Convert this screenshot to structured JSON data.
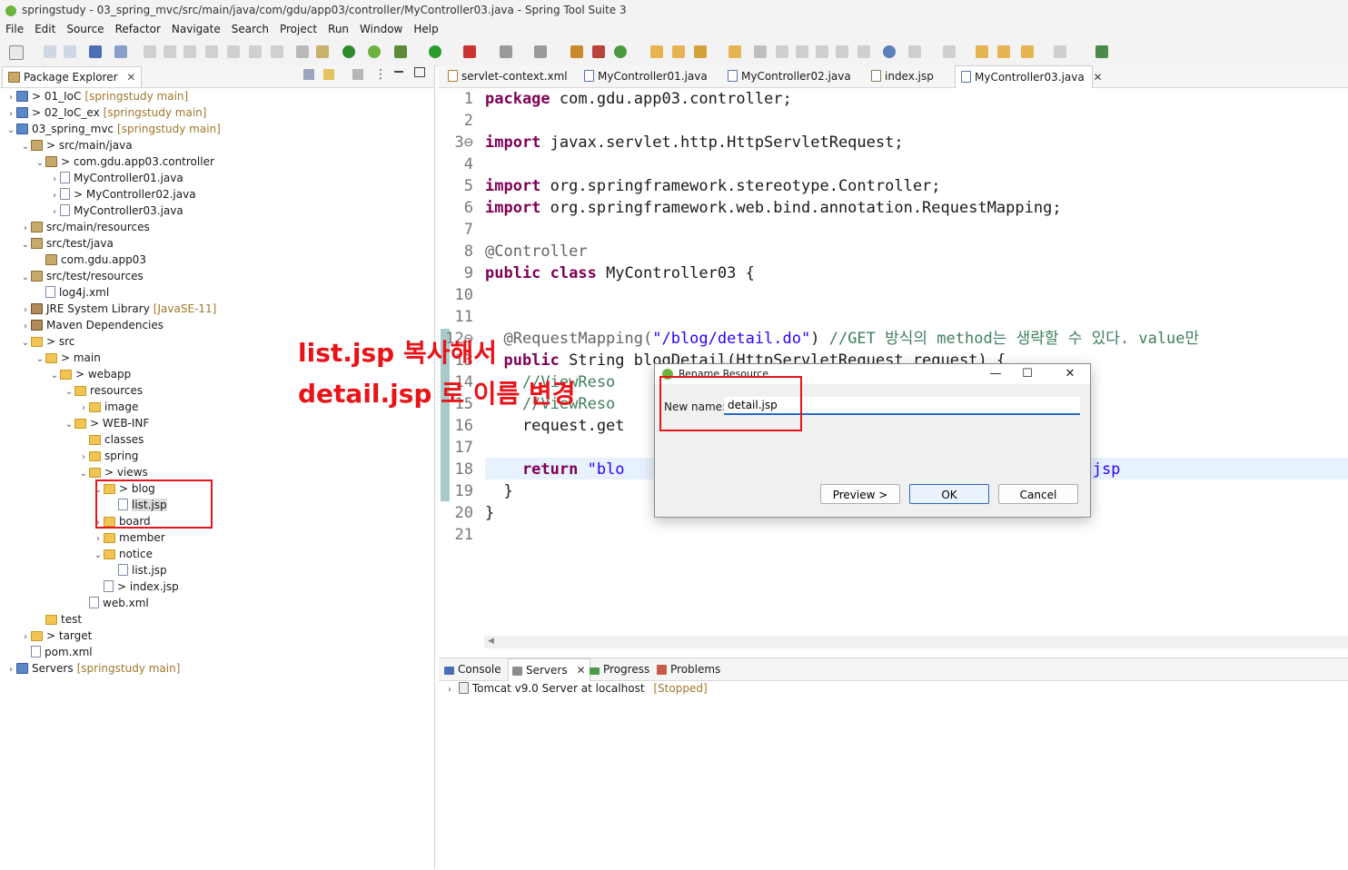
{
  "window": {
    "title": "springstudy - 03_spring_mvc/src/main/java/com/gdu/app03/controller/MyController03.java - Spring Tool Suite 3"
  },
  "menu": [
    "File",
    "Edit",
    "Source",
    "Refactor",
    "Navigate",
    "Search",
    "Project",
    "Run",
    "Window",
    "Help"
  ],
  "package_explorer": {
    "tab_label": "Package Explorer",
    "close_glyph": "✕",
    "tree": [
      {
        "label": "> 01_IoC",
        "suffix": "[springstudy main]",
        "icon": "project-icon",
        "twisty": "›"
      },
      {
        "label": "> 02_IoC_ex",
        "suffix": "[springstudy main]",
        "icon": "project-icon",
        "twisty": "›"
      },
      {
        "label": "03_spring_mvc",
        "suffix": "[springstudy main]",
        "icon": "project-icon",
        "twisty": "⌄"
      },
      {
        "label": "> src/main/java",
        "suffix": "",
        "icon": "source-folder-icon",
        "twisty": "⌄"
      },
      {
        "label": "> com.gdu.app03.controller",
        "suffix": "",
        "icon": "package-icon",
        "twisty": "⌄"
      },
      {
        "label": "MyController01.java",
        "suffix": "",
        "icon": "java-file-icon",
        "twisty": "›"
      },
      {
        "label": "> MyController02.java",
        "suffix": "",
        "icon": "java-file-icon",
        "twisty": "›"
      },
      {
        "label": "MyController03.java",
        "suffix": "",
        "icon": "java-file-icon",
        "twisty": "›"
      },
      {
        "label": "src/main/resources",
        "suffix": "",
        "icon": "source-folder-icon",
        "twisty": "›"
      },
      {
        "label": "src/test/java",
        "suffix": "",
        "icon": "source-folder-icon",
        "twisty": "⌄"
      },
      {
        "label": "com.gdu.app03",
        "suffix": "",
        "icon": "package-icon",
        "twisty": ""
      },
      {
        "label": "src/test/resources",
        "suffix": "",
        "icon": "source-folder-icon",
        "twisty": "⌄"
      },
      {
        "label": "log4j.xml",
        "suffix": "",
        "icon": "xml-file-icon",
        "twisty": ""
      },
      {
        "label": "JRE System Library",
        "suffix": "[JavaSE-11]",
        "icon": "library-icon",
        "twisty": "›"
      },
      {
        "label": "Maven Dependencies",
        "suffix": "",
        "icon": "library-icon",
        "twisty": "›"
      },
      {
        "label": "> src",
        "suffix": "",
        "icon": "folder-icon",
        "twisty": "⌄"
      },
      {
        "label": "> main",
        "suffix": "",
        "icon": "folder-icon",
        "twisty": "⌄"
      },
      {
        "label": "> webapp",
        "suffix": "",
        "icon": "folder-icon",
        "twisty": "⌄"
      },
      {
        "label": "resources",
        "suffix": "",
        "icon": "folder-icon",
        "twisty": "⌄"
      },
      {
        "label": "image",
        "suffix": "",
        "icon": "folder-icon",
        "twisty": "›"
      },
      {
        "label": "> WEB-INF",
        "suffix": "",
        "icon": "folder-icon",
        "twisty": "⌄"
      },
      {
        "label": "classes",
        "suffix": "",
        "icon": "folder-icon",
        "twisty": ""
      },
      {
        "label": "spring",
        "suffix": "",
        "icon": "folder-icon",
        "twisty": "›"
      },
      {
        "label": "> views",
        "suffix": "",
        "icon": "folder-icon",
        "twisty": "⌄"
      },
      {
        "label": "> blog",
        "suffix": "",
        "icon": "folder-icon",
        "twisty": "⌄"
      },
      {
        "label": "list.jsp",
        "suffix": "",
        "icon": "jsp-file-icon",
        "twisty": ""
      },
      {
        "label": "board",
        "suffix": "",
        "icon": "folder-icon",
        "twisty": "›"
      },
      {
        "label": "member",
        "suffix": "",
        "icon": "folder-icon",
        "twisty": "›"
      },
      {
        "label": "notice",
        "suffix": "",
        "icon": "folder-icon",
        "twisty": "⌄"
      },
      {
        "label": "list.jsp",
        "suffix": "",
        "icon": "jsp-file-icon",
        "twisty": ""
      },
      {
        "label": "> index.jsp",
        "suffix": "",
        "icon": "jsp-file-icon",
        "twisty": ""
      },
      {
        "label": "web.xml",
        "suffix": "",
        "icon": "xml-file-icon",
        "twisty": ""
      },
      {
        "label": "test",
        "suffix": "",
        "icon": "folder-icon",
        "twisty": ""
      },
      {
        "label": "> target",
        "suffix": "",
        "icon": "folder-icon",
        "twisty": "›"
      },
      {
        "label": "pom.xml",
        "suffix": "",
        "icon": "xml-file-icon",
        "twisty": ""
      },
      {
        "label": "Servers",
        "suffix": "[springstudy main]",
        "icon": "project-icon",
        "twisty": "›"
      }
    ]
  },
  "editor": {
    "tabs": [
      {
        "label": "servlet-context.xml",
        "active": false
      },
      {
        "label": "MyController01.java",
        "active": false
      },
      {
        "label": "MyController02.java",
        "active": false
      },
      {
        "label": "index.jsp",
        "active": false
      },
      {
        "label": "MyController03.java",
        "active": true
      }
    ],
    "close_glyph": "✕",
    "line_numbers": [
      "1",
      "2",
      "3⊖",
      "4",
      "5",
      "6",
      "7",
      "8",
      "9",
      "10",
      "11",
      "12⊖",
      "13",
      "14",
      "15",
      "16",
      "17",
      "18",
      "19",
      "20",
      "21"
    ],
    "lines": {
      "l1": {
        "kw": "package",
        "rest": " com.gdu.app03.controller;"
      },
      "l3": {
        "kw": "import",
        "rest": " javax.servlet.http.HttpServletRequest;"
      },
      "l5": {
        "kw": "import",
        "rest": " org.springframework.stereotype.Controller;"
      },
      "l6": {
        "kw": "import",
        "rest": " org.springframework.web.bind.annotation.RequestMapping;"
      },
      "l8": {
        "ann": "@Controller"
      },
      "l9": {
        "kw": "public class",
        "rest": " MyController03 {"
      },
      "l12": {
        "ann": "  @RequestMapping(",
        "str": "\"/blog/detail.do\"",
        "rest": ") ",
        "cm": "//GET 방식의 method는 생략할 수 있다. value만"
      },
      "l13": {
        "kw": "  public",
        "rest": " String blogDetail(HttpServletRequest request) {"
      },
      "l14": {
        "cm": "    //ViewReso"
      },
      "l15": {
        "cm": "    //ViewReso"
      },
      "l16": {
        "rest": "    request.get"
      },
      "l18": {
        "kw": "    return",
        "str": " \"blo",
        "tail": "il.jsp"
      },
      "l19": {
        "rest": "  }"
      },
      "l20": {
        "rest": "}"
      }
    }
  },
  "console": {
    "tabs": [
      {
        "label": "Console",
        "icon": "console-icon"
      },
      {
        "label": "Servers",
        "icon": "servers-icon"
      },
      {
        "label": "Progress",
        "icon": "progress-icon"
      },
      {
        "label": "Problems",
        "icon": "problems-icon"
      }
    ],
    "close_glyph": "✕",
    "server": {
      "name": "Tomcat v9.0 Server at localhost",
      "status": "[Stopped]"
    }
  },
  "dialog": {
    "title": "Rename Resource",
    "label": "New name:",
    "value": "detail.jsp",
    "buttons": {
      "preview": "Preview >",
      "ok": "OK",
      "cancel": "Cancel"
    },
    "minimize": "—",
    "maximize": "☐",
    "close": "✕"
  },
  "annotation": {
    "line1": "list.jsp 복사해서",
    "line2": "detail.jsp 로 이름 변경",
    "color": "#e8141a"
  }
}
